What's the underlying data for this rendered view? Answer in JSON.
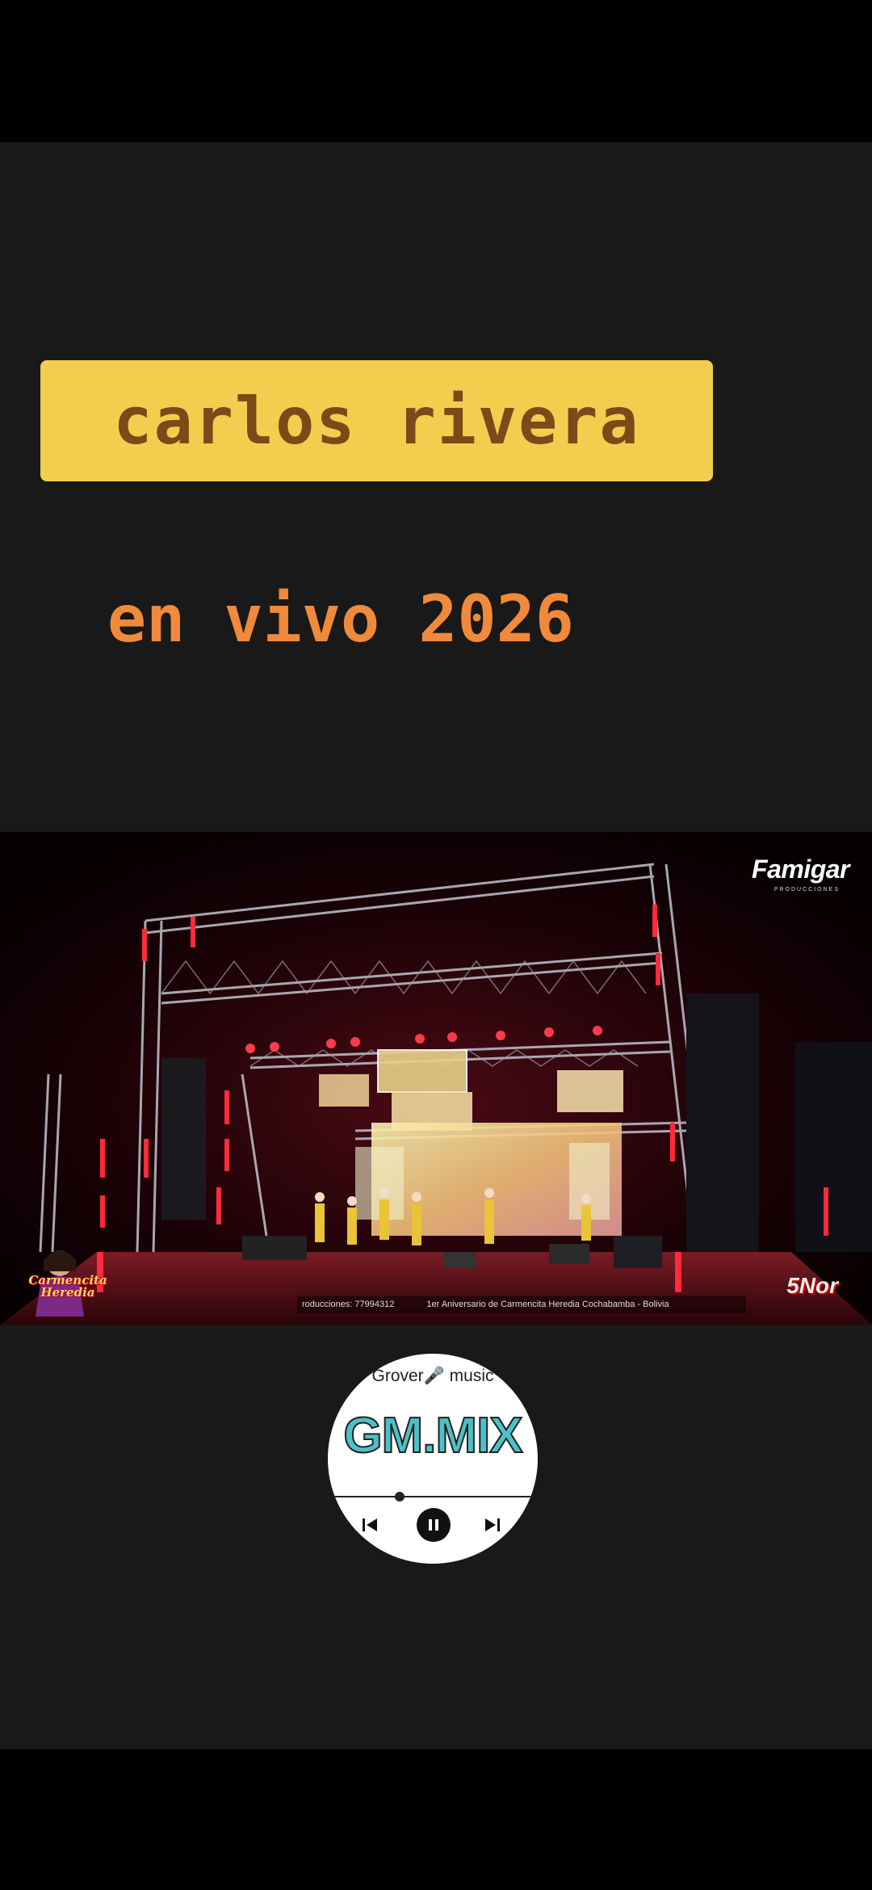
{
  "overlay": {
    "title": "carlos rivera",
    "subtitle": "en vivo 2026",
    "title_bg_color": "#f1ce4d",
    "title_text_color": "#7a4a18",
    "subtitle_color": "#f08a3a"
  },
  "video": {
    "watermark": "Famigar",
    "watermark_sub": "PRODUCCIONES",
    "ticker_items": [
      "roducciones: 77994312",
      "1er Aniversario de Carmencita Heredia   Cochabamba - Bolivia"
    ],
    "left_logo_text": "Carmencita Heredia",
    "right_logo_text": "5Nor"
  },
  "player": {
    "top_label": "Grover🎤 music",
    "brand": "GM.MIX",
    "progress": 0.33,
    "prev_icon": "skip-previous-icon",
    "play_icon": "pause-icon",
    "next_icon": "skip-next-icon",
    "brand_color": "#4cc1c8"
  }
}
